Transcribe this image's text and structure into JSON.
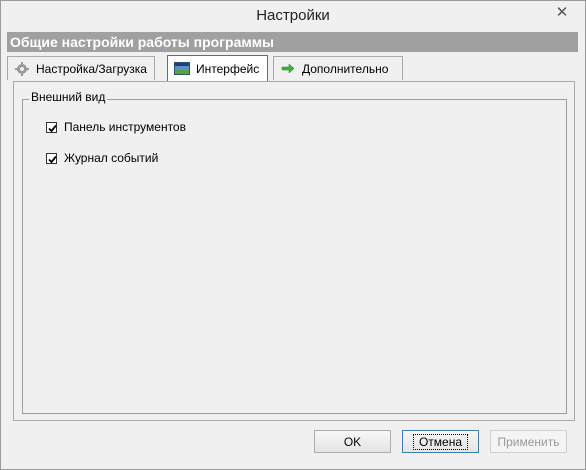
{
  "window": {
    "title": "Настройки"
  },
  "header": {
    "title": "Общие настройки работы программы"
  },
  "tabs": [
    {
      "label": "Настройка/Загрузка",
      "icon": "gear-icon",
      "active": false
    },
    {
      "label": "Интерфейс",
      "icon": "interface-image-icon",
      "active": true
    },
    {
      "label": "Дополнительно",
      "icon": "arrow-right-icon",
      "active": false
    }
  ],
  "appearance": {
    "legend": "Внешний вид",
    "toolbar_label": "Панель инструментов",
    "toolbar_checked": true,
    "journal_label": "Журнал событий",
    "journal_checked": true
  },
  "buttons": {
    "ok": "OK",
    "cancel": "Отмена",
    "apply": "Применить"
  },
  "colors": {
    "header_band": "#a0a0a0",
    "arrow_icon": "#3cb043"
  }
}
